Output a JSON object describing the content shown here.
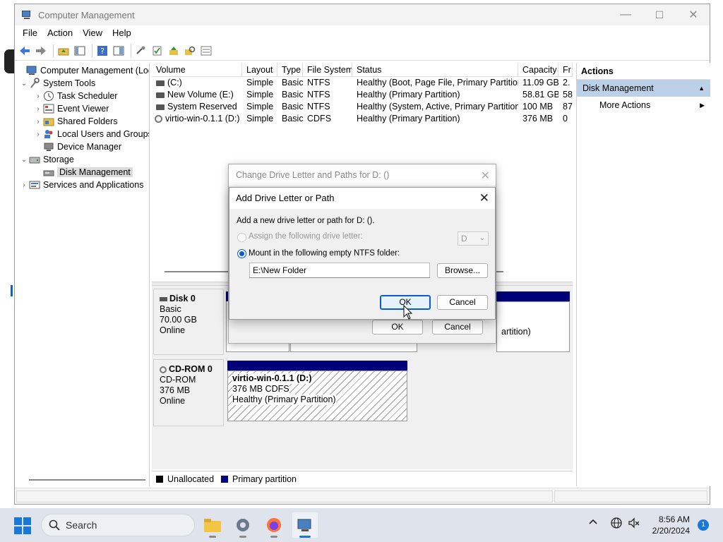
{
  "window": {
    "title": "Computer Management",
    "controls": {
      "minimize": "—",
      "maximize": "☐",
      "close": "✕"
    }
  },
  "menu": [
    "File",
    "Action",
    "View",
    "Help"
  ],
  "tree": {
    "root": "Computer Management (Local",
    "system_tools": "System Tools",
    "task_scheduler": "Task Scheduler",
    "event_viewer": "Event Viewer",
    "shared_folders": "Shared Folders",
    "local_users": "Local Users and Groups",
    "device_manager": "Device Manager",
    "storage": "Storage",
    "disk_management": "Disk Management",
    "services": "Services and Applications"
  },
  "volumes": {
    "headers": [
      "Volume",
      "Layout",
      "Type",
      "File System",
      "Status",
      "Capacity",
      "Fr"
    ],
    "rows": [
      [
        "(C:)",
        "Simple",
        "Basic",
        "NTFS",
        "Healthy (Boot, Page File, Primary Partition)",
        "11.09 GB",
        "2."
      ],
      [
        "New Volume (E:)",
        "Simple",
        "Basic",
        "NTFS",
        "Healthy (Primary Partition)",
        "58.81 GB",
        "58"
      ],
      [
        "System Reserved",
        "Simple",
        "Basic",
        "NTFS",
        "Healthy (System, Active, Primary Partition)",
        "100 MB",
        "87"
      ],
      [
        "virtio-win-0.1.1 (D:)",
        "Simple",
        "Basic",
        "CDFS",
        "Healthy (Primary Partition)",
        "376 MB",
        "0"
      ]
    ]
  },
  "disk0": {
    "name": "Disk 0",
    "type": "Basic",
    "size": "70.00 GB",
    "state": "Online",
    "partial_text": "artition)"
  },
  "cdrom0": {
    "name": "CD-ROM 0",
    "type": "CD-ROM",
    "size": "376 MB",
    "state": "Online",
    "part_name": "virtio-win-0.1.1  (D:)",
    "part_size": "376 MB CDFS",
    "part_status": "Healthy (Primary Partition)"
  },
  "legend": {
    "unallocated": "Unallocated",
    "primary": "Primary partition"
  },
  "actions": {
    "header": "Actions",
    "section": "Disk Management",
    "more": "More Actions"
  },
  "dialog_back": {
    "title": "Change Drive Letter and Paths for D: ()",
    "ok": "OK",
    "cancel": "Cancel"
  },
  "dialog": {
    "title": "Add Drive Letter or Path",
    "prompt": "Add a new drive letter or path for D: ().",
    "opt_letter": "Assign the following drive letter:",
    "letter_value": "D",
    "opt_folder": "Mount in the following empty NTFS folder:",
    "folder_value": "E:\\New Folder",
    "browse": "Browse...",
    "ok": "OK",
    "cancel": "Cancel"
  },
  "taskbar": {
    "search_placeholder": "Search",
    "time": "8:56 AM",
    "date": "2/20/2024",
    "notifications": "1"
  },
  "colors": {
    "primary_partition": "#00007a",
    "accent": "#1a78d8",
    "selection": "#bcd1e8"
  }
}
